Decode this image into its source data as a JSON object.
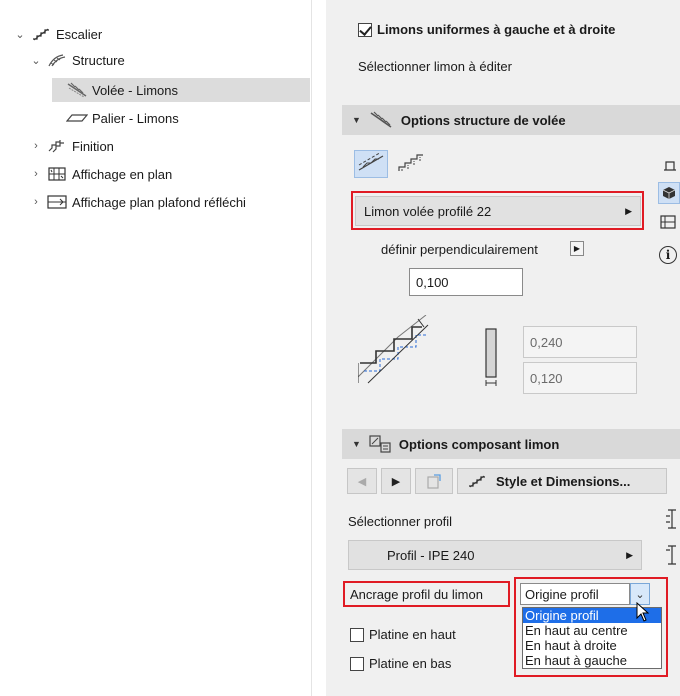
{
  "tree": {
    "items": [
      {
        "label": "Escalier",
        "expanded": true,
        "icon": "stair-icon"
      },
      {
        "label": "Structure",
        "expanded": true,
        "icon": "structure-icon"
      },
      {
        "label": "Volée - Limons",
        "selected": true,
        "icon": "flight-stringer-icon"
      },
      {
        "label": "Palier - Limons",
        "icon": "landing-stringer-icon"
      },
      {
        "label": "Finition",
        "expanded": false,
        "icon": "finish-icon"
      },
      {
        "label": "Affichage en plan",
        "expanded": false,
        "icon": "floor-plan-icon"
      },
      {
        "label": "Affichage plan plafond réfléchi",
        "expanded": false,
        "icon": "ceiling-plan-icon"
      }
    ]
  },
  "panel": {
    "uniform_checkbox": {
      "label": "Limons uniformes à gauche et à droite",
      "checked": true
    },
    "select_stringer_label": "Sélectionner limon à éditer",
    "structure_section": {
      "title": "Options structure de volée",
      "profile_popup": "Limon volée profilé 22",
      "perpendicular_label": "définir perpendiculairement",
      "offset_value": "0,100",
      "height_value": "0,240",
      "width_value": "0,120"
    },
    "component_section": {
      "title": "Options composant limon",
      "style_button": "Style et Dimensions...",
      "select_profile_label": "Sélectionner profil",
      "profile_value": "Profil - IPE 240",
      "anchor_label": "Ancrage profil du limon",
      "anchor_selected": "Origine profil",
      "anchor_options": [
        "Origine profil",
        "En haut au centre",
        "En haut à droite",
        "En haut à gauche"
      ],
      "plate_top_label": "Platine en haut",
      "plate_bottom_label": "Platine en bas"
    }
  },
  "colors": {
    "highlight_box": "#e01b24",
    "selection_blue": "#1e6ee8",
    "section_header": "#d9d9d9"
  }
}
